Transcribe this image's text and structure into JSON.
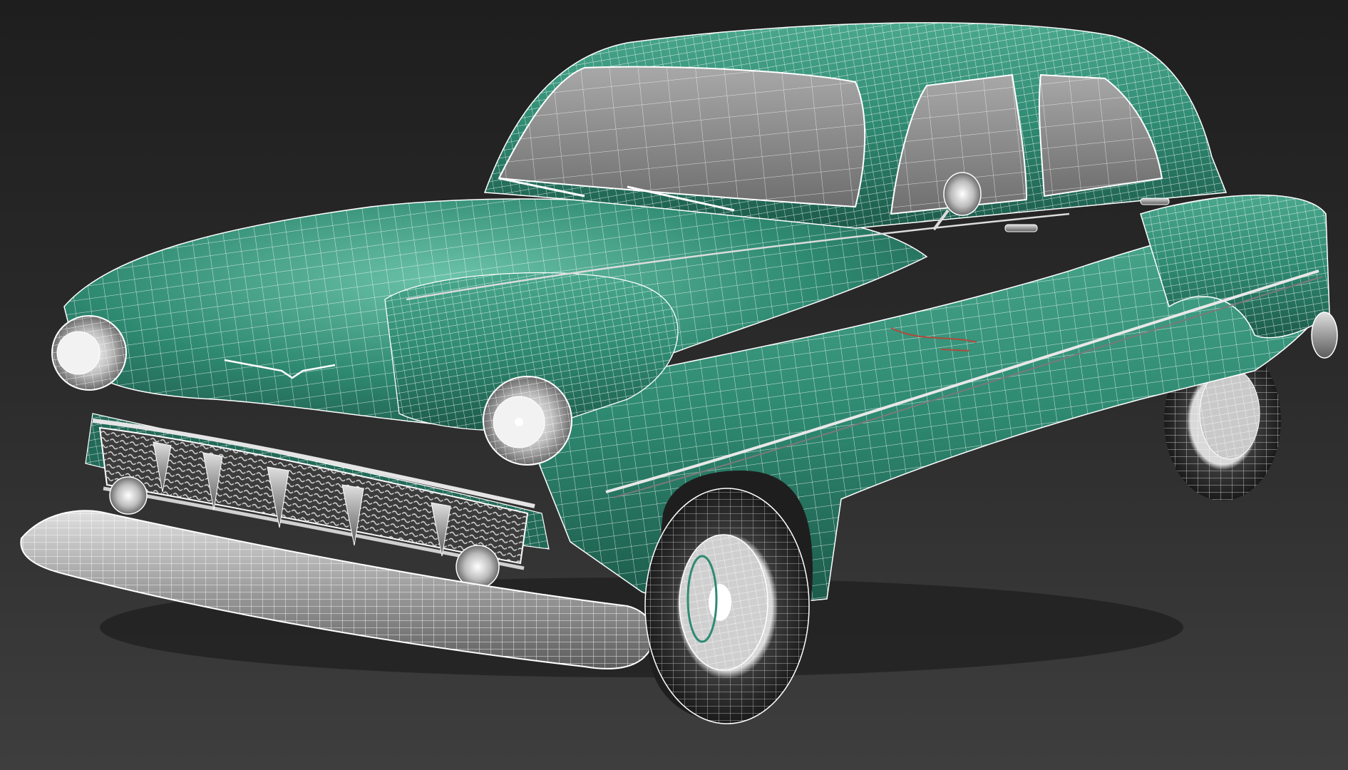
{
  "viewport": {
    "background_top": "#1e1e1e",
    "background_bottom": "#3e3e3e",
    "render_mode": "smooth-shaded-with-wireframe-edges",
    "wire_color": "#ffffff"
  },
  "model": {
    "body_color": "#2f8a72",
    "body_shadow_color": "#1c5a4a",
    "body_highlight_color": "#6cc3a8",
    "chrome_color": "#b9b9b9",
    "tire_color": "#2b2b2b",
    "glass_color": "#9a9a9a",
    "icons": [
      "headlight-icon",
      "grille-icon",
      "bumper-icon",
      "wheel-icon",
      "side-mirror-icon",
      "hood-emblem-icon"
    ]
  }
}
